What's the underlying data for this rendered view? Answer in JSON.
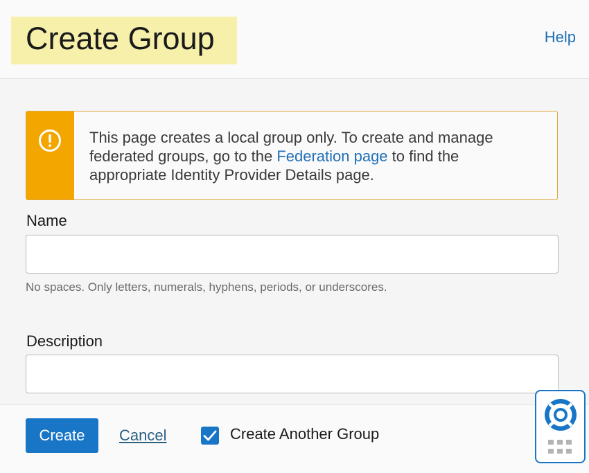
{
  "header": {
    "title": "Create Group",
    "help_label": "Help"
  },
  "warning": {
    "text_before_link": "This page creates a local group only. To create and manage federated groups, go to the ",
    "link_text": "Federation page",
    "text_after_link": " to find the appropriate Identity Provider Details page.",
    "accent_color": "#f3a600",
    "icon": "exclamation-circle-icon"
  },
  "form": {
    "name_label": "Name",
    "name_value": "",
    "name_hint": "No spaces. Only letters, numerals, hyphens, periods, or underscores.",
    "description_label": "Description",
    "description_value": ""
  },
  "footer": {
    "create_label": "Create",
    "cancel_label": "Cancel",
    "create_another_label": "Create Another Group",
    "create_another_checked": true
  },
  "colors": {
    "primary": "#1976c7",
    "link": "#1f6fb7",
    "title_highlight": "#f6f0ab"
  },
  "widgets": {
    "help_widget_icon": "lifebuoy-icon",
    "grid_icon": "grid-dots-icon"
  }
}
